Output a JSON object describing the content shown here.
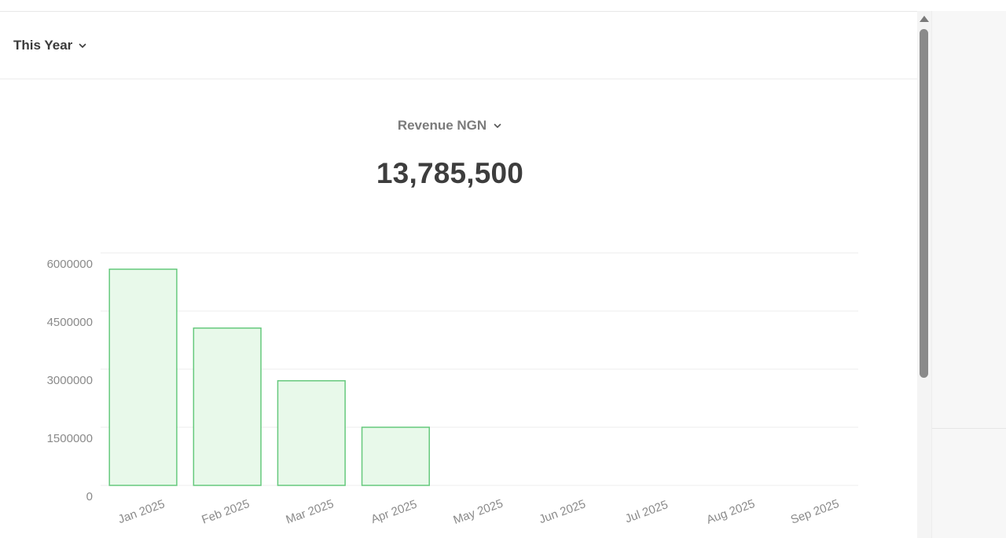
{
  "filters": {
    "period_label": "This Year",
    "metric_label": "Revenue NGN"
  },
  "summary": {
    "total": "13,785,500"
  },
  "colors": {
    "bar_fill": "#e8f9ea",
    "bar_stroke": "#66c97d",
    "grid": "#ececec",
    "tick_text": "#8a8a8a"
  },
  "chart_data": {
    "type": "bar",
    "categories": [
      "Jan 2025",
      "Feb 2025",
      "Mar 2025",
      "Apr 2025",
      "May 2025",
      "Jun 2025",
      "Jul 2025",
      "Aug 2025",
      "Sep 2025"
    ],
    "values": [
      5580000,
      4060000,
      2700000,
      1500000,
      0,
      0,
      0,
      0,
      0
    ],
    "ylim": [
      0,
      6000000
    ],
    "yticks": [
      "0",
      "1500000",
      "3000000",
      "4500000",
      "6000000"
    ],
    "grid": true
  }
}
